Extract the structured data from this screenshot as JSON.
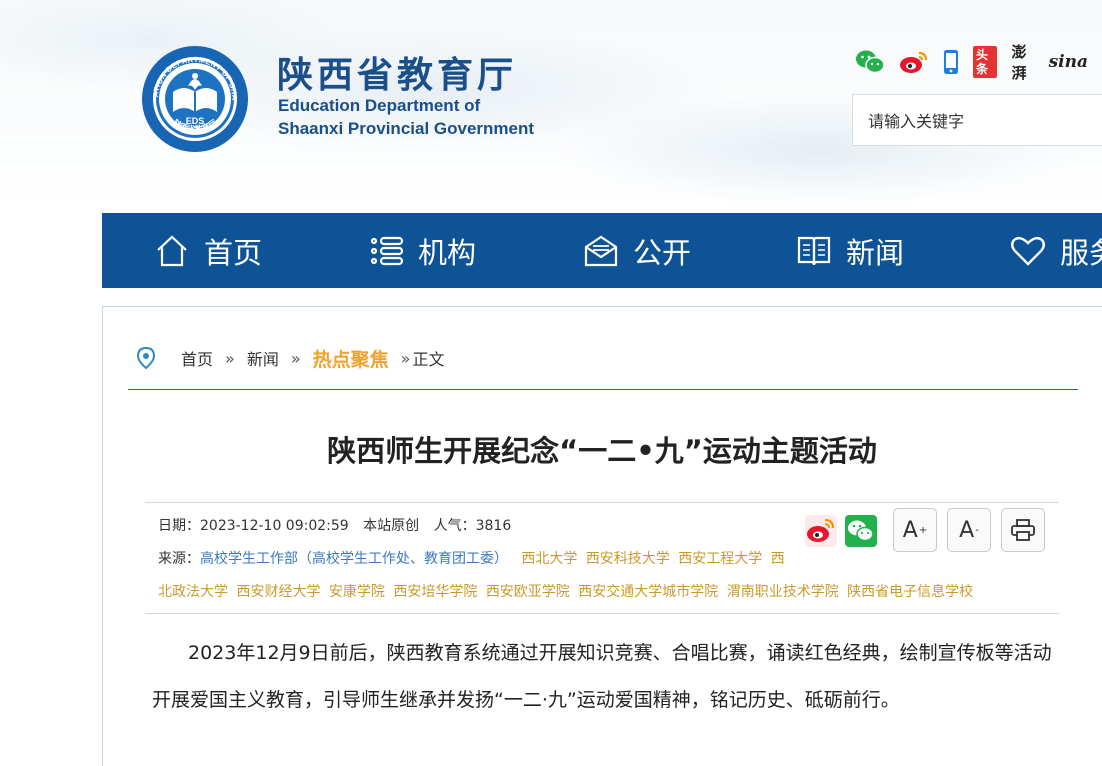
{
  "header": {
    "seal_text_top": "EDUCATION DEPARTMENT OF SHAANXI",
    "seal_text_bottom": "陕西省教育厅",
    "seal_center": "EDS",
    "site_name_cn": "陕西省教育厅",
    "site_name_en_line1": "Education Department of",
    "site_name_en_line2": "Shaanxi Provincial Government",
    "social": {
      "toutiao": "头条",
      "pengpai": "澎湃",
      "sina": "sina"
    },
    "search_placeholder": "请输入关键字"
  },
  "nav": {
    "items": [
      {
        "label": "首页",
        "icon": "home-icon"
      },
      {
        "label": "机构",
        "icon": "list-icon"
      },
      {
        "label": "公开",
        "icon": "mail-icon"
      },
      {
        "label": "新闻",
        "icon": "book-icon"
      },
      {
        "label": "服务",
        "icon": "heart-icon"
      }
    ]
  },
  "breadcrumb": {
    "home": "首页",
    "news": "新闻",
    "hot": "热点聚焦",
    "current": "正文",
    "sep": "»"
  },
  "article": {
    "title": "陕西师生开展纪念“一二•九”运动主题活动",
    "date_label": "日期：",
    "date": "2023-12-10 09:02:59",
    "origin": "本站原创",
    "views_label": "人气：",
    "views": "3816",
    "source_label": "来源：",
    "source_main": "高校学生工作部（高校学生工作处、教育团工委）",
    "schools_line1": [
      "西北大学",
      "西安科技大学",
      "西安工程大学",
      "西"
    ],
    "schools_line2": [
      "北政法大学",
      "西安财经大学",
      "安康学院",
      "西安培华学院",
      "西安欧亚学院",
      "西安交通大学城市学院",
      "渭南职业技术学院",
      "陕西省电子信息学校"
    ],
    "font_larger": "A",
    "font_smaller": "A",
    "body": "2023年12月9日前后，陕西教育系统通过开展知识竞赛、合唱比赛，诵读红色经典，绘制宣传板等活动开展爱国主义教育，引导师生继承并发扬“一二·九”运动爱国精神，铭记历史、砥砺前行。"
  }
}
